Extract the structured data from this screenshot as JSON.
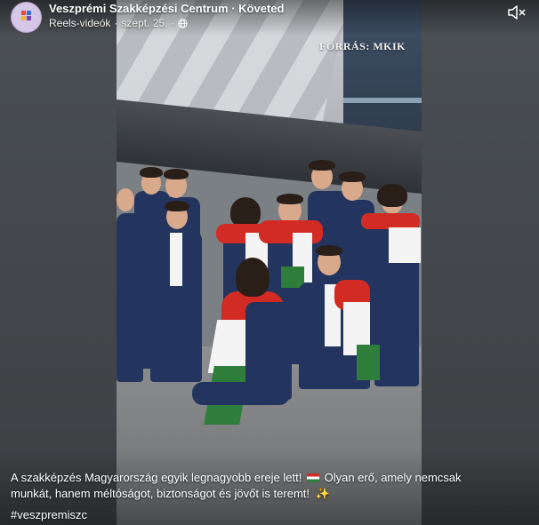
{
  "post": {
    "page_name": "Veszprémi Szakképzési Centrum · Követed",
    "meta_type": "Reels-videók",
    "meta_sep": "·",
    "meta_date": "szept. 25.",
    "meta_tail": "·",
    "privacy_icon": "globe-icon",
    "mute_icon": "speaker-muted-icon"
  },
  "video": {
    "watermark": "FORRÁS: MKIK"
  },
  "caption": {
    "line1_a": "A szakképzés Magyarország egyik legnagyobb ereje lett!",
    "line1_b": "Olyan erő, amely nemcsak",
    "line2": "munkát, hanem méltóságot, biztonságot és jövőt is teremt!",
    "flag_emoji": "hungary-flag-emoji",
    "sparkle_emoji": "sparkles-emoji",
    "hashtag": "#veszpremiszc"
  },
  "colors": {
    "flag_red": "#d12b24",
    "flag_white": "#f4f4f4",
    "flag_green": "#2f7d3a",
    "suit_navy": "#23355f"
  }
}
